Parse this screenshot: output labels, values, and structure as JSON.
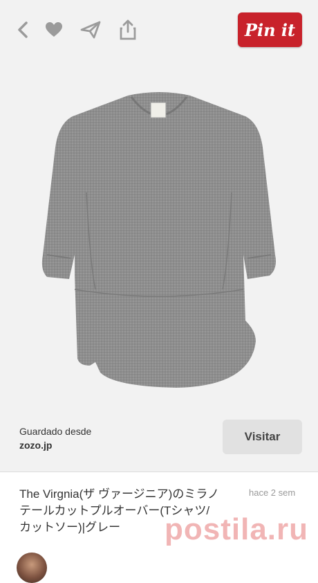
{
  "toolbar": {
    "pin_it_label": "Pin it",
    "icons": [
      "back-icon",
      "heart-icon",
      "send-icon",
      "share-icon"
    ]
  },
  "source": {
    "saved_label": "Guardado desde",
    "domain": "zozo.jp",
    "visit_label": "Visitar"
  },
  "pin": {
    "description_lines": [
      "The Virgnia(ザ ヴァージニア)のミラノ",
      "テールカットプルオーバー(Tシャツ/",
      "カットソー)|グレー"
    ],
    "time": "hace 2 sem"
  },
  "watermark": "postila.ru",
  "colors": {
    "pin_it_red": "#c8222b",
    "background": "#f2f2f2",
    "visit_button": "#e1e1e1"
  }
}
